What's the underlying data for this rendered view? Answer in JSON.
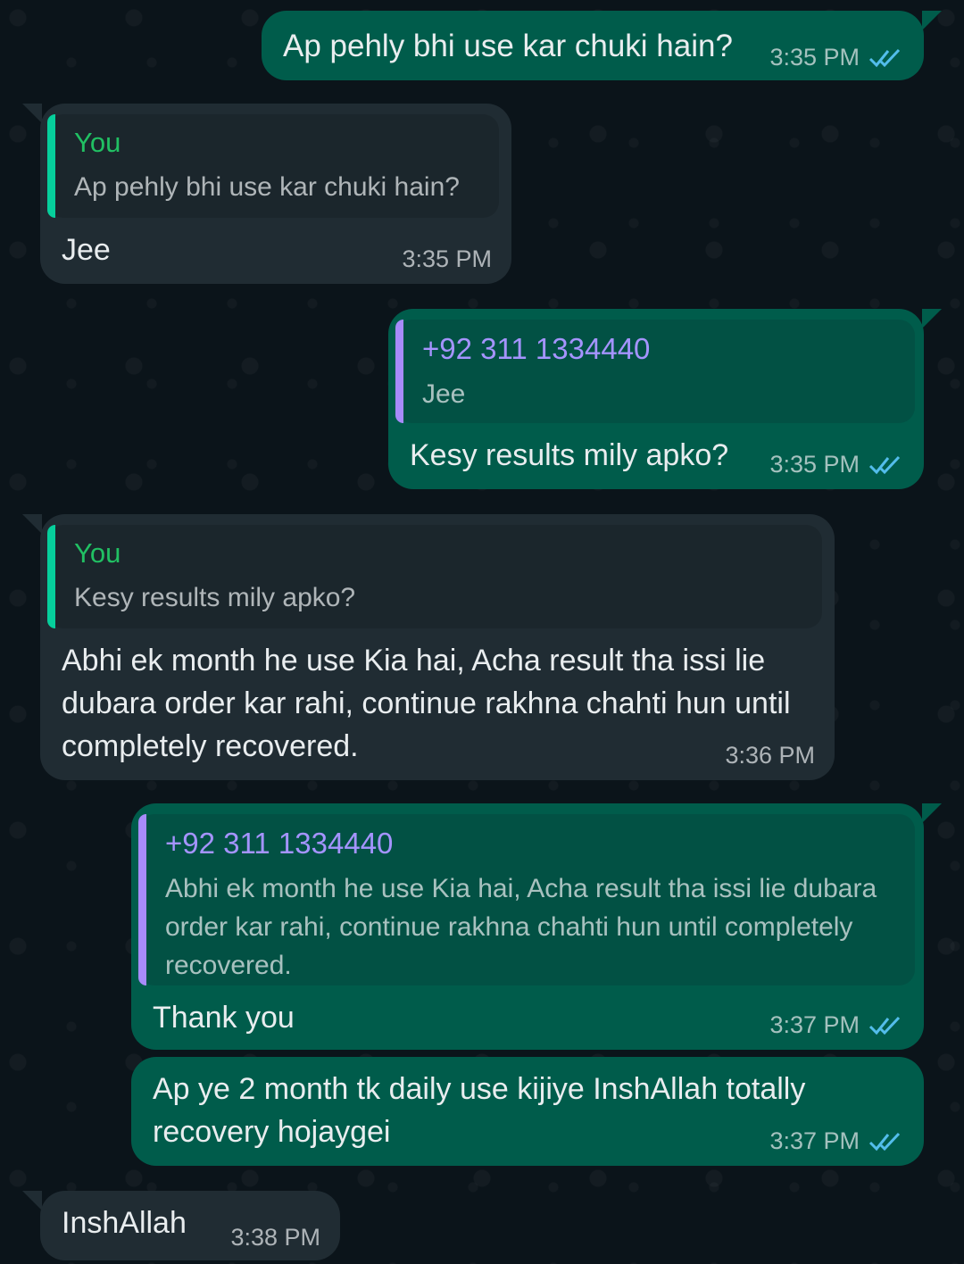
{
  "colors": {
    "background": "#0b141a",
    "outgoing_bubble": "#005c4b",
    "incoming_bubble": "#202c33",
    "read_ticks": "#53bdeb"
  },
  "messages": [
    {
      "direction": "out",
      "text": "Ap pehly bhi use kar chuki hain?",
      "time": "3:35 PM",
      "status_icon": "double-check-read-icon"
    },
    {
      "direction": "in",
      "reply": {
        "author": "You",
        "text": "Ap pehly bhi use kar chuki hain?"
      },
      "text": "Jee",
      "time": "3:35 PM"
    },
    {
      "direction": "out",
      "reply": {
        "author": "+92 311 1334440",
        "text": "Jee"
      },
      "text": "Kesy results mily apko?",
      "time": "3:35 PM",
      "status_icon": "double-check-read-icon"
    },
    {
      "direction": "in",
      "reply": {
        "author": "You",
        "text": "Kesy results mily apko?"
      },
      "text": "Abhi ek month he use Kia hai, Acha result tha issi lie dubara order kar rahi, continue rakhna chahti hun until completely recovered.",
      "time": "3:36 PM"
    },
    {
      "direction": "out",
      "reply": {
        "author": "+92 311 1334440",
        "text": "Abhi ek month he use Kia hai, Acha result tha issi lie dubara order kar rahi, continue rakhna chahti hun until completely recovered."
      },
      "text": "Thank you",
      "time": "3:37 PM",
      "status_icon": "double-check-read-icon"
    },
    {
      "direction": "out",
      "text": "Ap ye 2 month tk daily use kijiye InshAllah totally recovery hojaygei",
      "time": "3:37 PM",
      "status_icon": "double-check-read-icon"
    },
    {
      "direction": "in",
      "text": "InshAllah",
      "time": "3:38 PM"
    }
  ]
}
